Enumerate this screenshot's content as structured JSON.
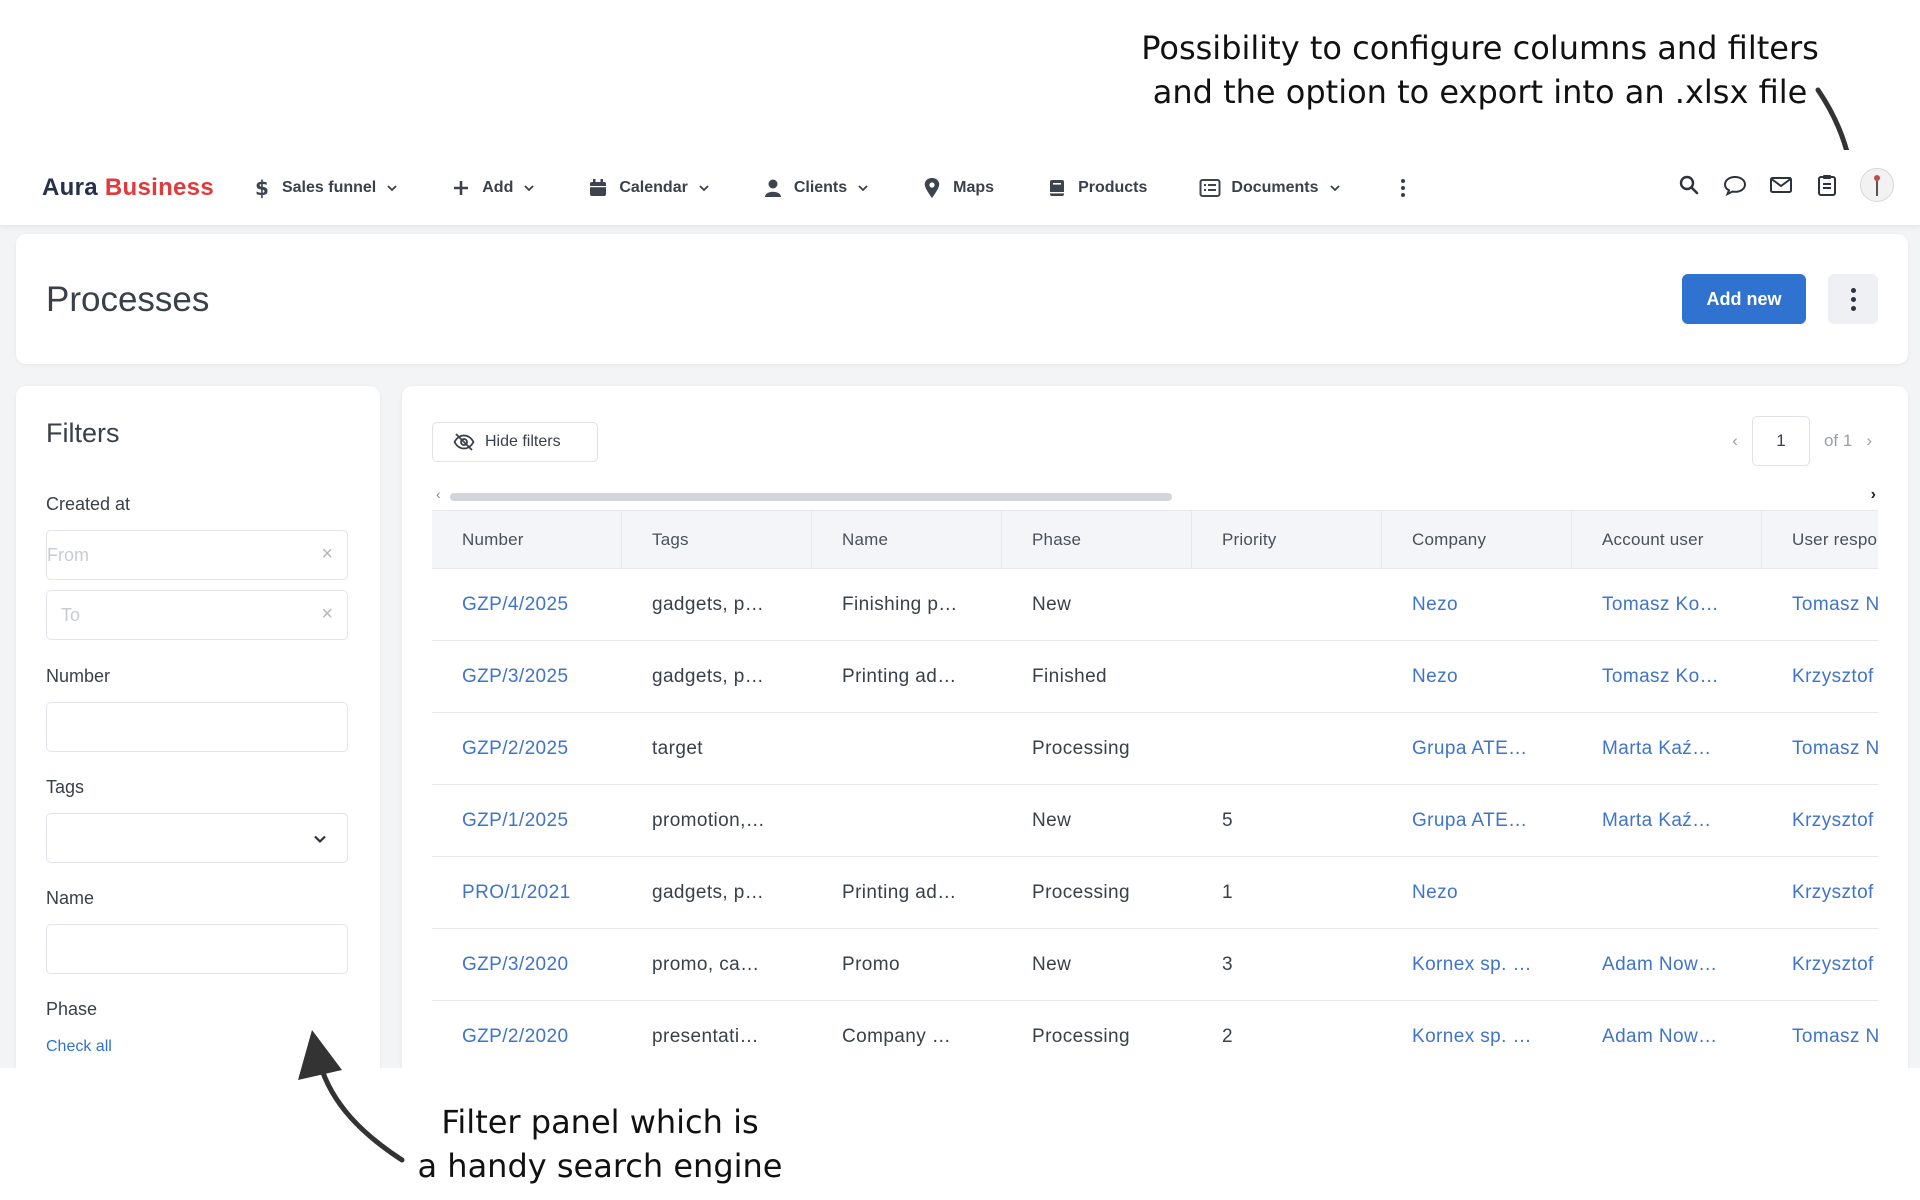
{
  "annotations": {
    "top_line1": "Possibility to configure columns and filters",
    "top_line2": "and the option to export into an .xlsx file",
    "bottom_line1": "Filter panel which is",
    "bottom_line2": "a handy search engine"
  },
  "logo": {
    "part1": "Aura",
    "part2": "Business"
  },
  "nav": {
    "items": [
      {
        "label": "Sales funnel",
        "icon": "dollar-icon",
        "dropdown": true
      },
      {
        "label": "Add",
        "icon": "plus-icon",
        "dropdown": true
      },
      {
        "label": "Calendar",
        "icon": "calendar-icon",
        "dropdown": true
      },
      {
        "label": "Clients",
        "icon": "user-icon",
        "dropdown": true
      },
      {
        "label": "Maps",
        "icon": "map-pin-icon",
        "dropdown": false
      },
      {
        "label": "Products",
        "icon": "book-icon",
        "dropdown": false
      },
      {
        "label": "Documents",
        "icon": "list-icon",
        "dropdown": true
      }
    ],
    "right_icons": [
      "search-icon",
      "chat-icon",
      "mail-icon",
      "clipboard-icon",
      "avatar"
    ]
  },
  "header": {
    "title": "Processes",
    "add_new_label": "Add new"
  },
  "filters": {
    "title": "Filters",
    "created_at_label": "Created at",
    "from_placeholder": "From",
    "to_placeholder": "To",
    "number_label": "Number",
    "tags_label": "Tags",
    "name_label": "Name",
    "phase_label": "Phase",
    "check_all_label": "Check all"
  },
  "table": {
    "hide_filters_label": "Hide filters",
    "page_current": "1",
    "page_of": "of 1",
    "columns": [
      "Number",
      "Tags",
      "Name",
      "Phase",
      "Priority",
      "Company",
      "Account user",
      "User respo"
    ],
    "rows": [
      [
        "GZP/4/2025",
        "gadgets, p…",
        "Finishing p…",
        "New",
        "",
        "Nezo",
        "Tomasz Ko…",
        "Tomasz N"
      ],
      [
        "GZP/3/2025",
        "gadgets, p…",
        "Printing ad…",
        "Finished",
        "",
        "Nezo",
        "Tomasz Ko…",
        "Krzysztof"
      ],
      [
        "GZP/2/2025",
        "target",
        "",
        "Processing",
        "",
        "Grupa ATE…",
        "Marta Kaź…",
        "Tomasz N"
      ],
      [
        "GZP/1/2025",
        "promotion,…",
        "",
        "New",
        "5",
        "Grupa ATE…",
        "Marta Kaź…",
        "Krzysztof"
      ],
      [
        "PRO/1/2021",
        "gadgets, p…",
        "Printing ad…",
        "Processing",
        "1",
        "Nezo",
        "",
        "Krzysztof"
      ],
      [
        "GZP/3/2020",
        "promo, ca…",
        "Promo",
        "New",
        "3",
        "Kornex sp. …",
        "Adam Now…",
        "Krzysztof"
      ],
      [
        "GZP/2/2020",
        "presentati…",
        "Company …",
        "Processing",
        "2",
        "Kornex sp. …",
        "Adam Now…",
        "Tomasz N"
      ]
    ]
  },
  "colors": {
    "accent": "#2f72d0",
    "link": "#3f74c9",
    "brand_red": "#e03a3a",
    "brand_dark": "#27304a"
  }
}
